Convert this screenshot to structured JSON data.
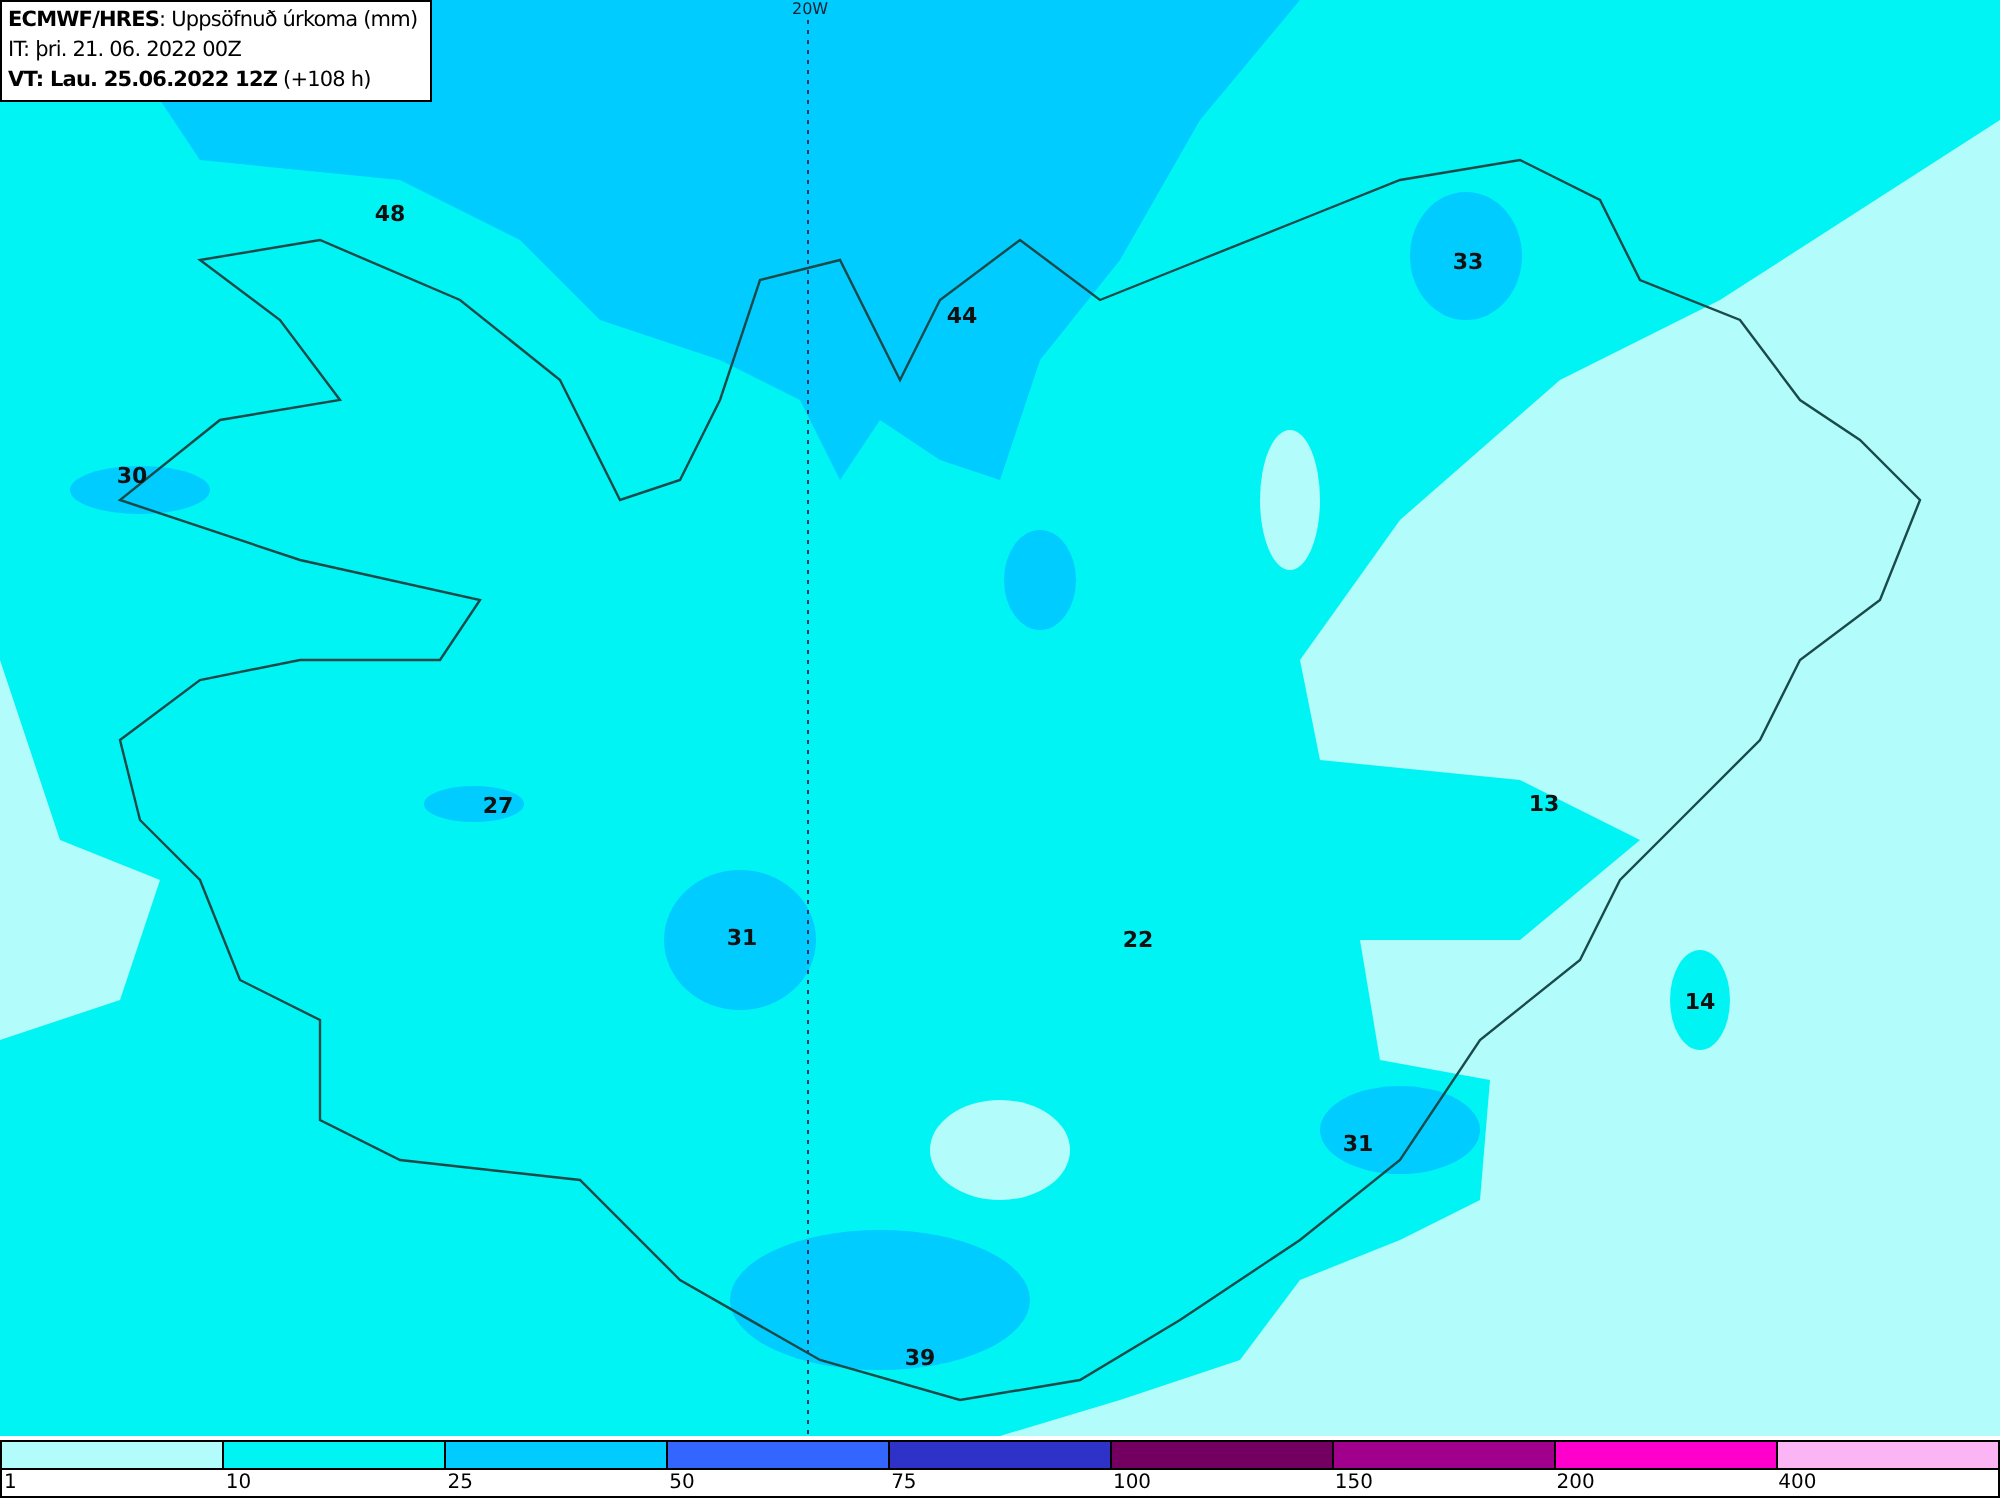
{
  "header": {
    "lines": [
      "**ECMWF/HRES**: Uppsöfnuð úrkoma (mm)",
      "IT: þri. 21. 06. 2022 00Z",
      "**VT: Lau. 25.06.2022 12Z** (+108 h)"
    ]
  },
  "map": {
    "meridian_label": "20W",
    "values": [
      "48",
      "44",
      "33",
      "30",
      "27",
      "31",
      "22",
      "13",
      "14",
      "31",
      "39"
    ]
  },
  "legend": [
    {
      "label": "1",
      "color": "#b3fcfc"
    },
    {
      "label": "10",
      "color": "#00f4f4"
    },
    {
      "label": "25",
      "color": "#00ccff"
    },
    {
      "label": "50",
      "color": "#3366ff"
    },
    {
      "label": "75",
      "color": "#2e32c8"
    },
    {
      "label": "100",
      "color": "#730060"
    },
    {
      "label": "150",
      "color": "#a0008c"
    },
    {
      "label": "200",
      "color": "#ff00cc"
    },
    {
      "label": "400",
      "color": "#fbb4f4"
    }
  ]
}
